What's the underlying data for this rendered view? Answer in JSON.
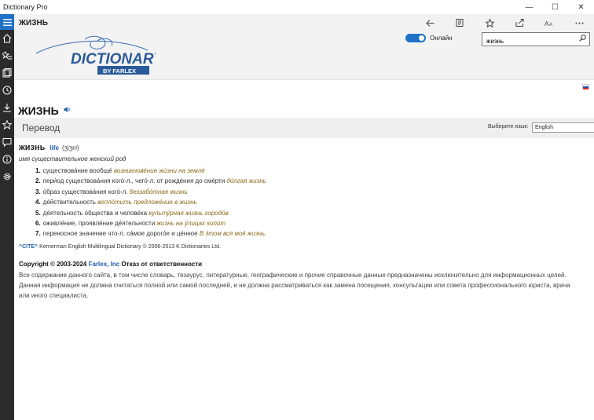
{
  "window": {
    "title": "Dictionary Pro",
    "minimize": "—",
    "maximize": "☐",
    "close": "✕"
  },
  "appbar": {
    "word": "ЖИЗНЬ",
    "tools": [
      "back-arrow-icon",
      "reader-icon",
      "favorite-star-icon",
      "share-icon",
      "font-size-icon"
    ]
  },
  "banner": {
    "logo_main": "DICTIONARY",
    "logo_sub": "BY FARLEX",
    "online_label": "Онлайн",
    "online_on": true,
    "search_value": "жизнь"
  },
  "headword": "ЖИЗНЬ",
  "translation": {
    "heading": "Перевод",
    "lang_label": "Выберите язык:",
    "lang_selected": "English"
  },
  "entry": {
    "word": "жизнь",
    "translation": "life",
    "pronunciation": "(ʒiʒnʲ)",
    "pos": "имя существительное женский род",
    "senses": [
      {
        "n": "1.",
        "text": "существова́ние вообще́ ",
        "ex": "возникнове́ние жи́зни на земле́"
      },
      {
        "n": "2.",
        "text": "пери́од существова́ния кого́-л., чего́-л. от рожде́ния до сме́рти ",
        "ex": "до́лгая жизнь"
      },
      {
        "n": "3.",
        "text": "о́браз существова́ния кого́-л. ",
        "ex": "беззабо́тная жизнь"
      },
      {
        "n": "4.",
        "text": "де́йствительность ",
        "ex": "вопло́тить предложе́ние в жизнь"
      },
      {
        "n": "5.",
        "text": "де́ятельность о́бщества и челове́ка ",
        "ex": "культу́рная жизнь городо́в"
      },
      {
        "n": "6.",
        "text": "оживле́ние, проявле́ние де́ятельности ",
        "ex": "жизнь на у́лицах кипи́т"
      },
      {
        "n": "7.",
        "text": "переносное значение что-л. са́мое дорого́е и це́нное ",
        "ex": "В э́том вся моя́ жизнь."
      }
    ],
    "cite_tag": "^CITE^",
    "cite_text": "Kernerman English Multilingual Dictionary © 2006-2013 K Dictionaries Ltd."
  },
  "footer": {
    "copyright_prefix": "Copyright © 2003-2024",
    "copyright_farlex": "Farlex, Inc",
    "copyright_suffix": "Отказ от ответственности",
    "disclaimer": "Все содержание данного сайта, в том числе словарь, тезаурус, литературные, географические и прочие справочные данные предназначены исключительно для информационных целей. Данная информация не должна считаться полной или самой последней, и не должна рассматриваться как замена посещения, консультации или совета профессионального юриста, врача или иного специалиста."
  },
  "colors": {
    "accent": "#1f72c8",
    "rail": "#2b2b2b",
    "example": "#8a6a1a",
    "link": "#1f5fb0"
  }
}
